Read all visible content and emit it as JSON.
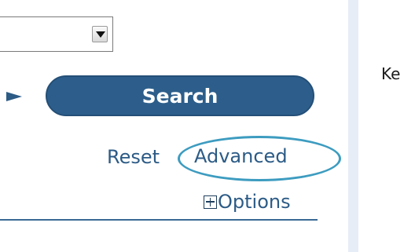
{
  "search_form": {
    "select": {
      "selected_value": ""
    },
    "search_label": "Search",
    "reset_label": "Reset",
    "advanced_label": "Advanced",
    "options_label": "Options"
  },
  "right_panel": {
    "keyword_label": "Ke"
  },
  "colors": {
    "button_bg": "#2d5e8b",
    "link": "#2c5b86",
    "highlight_ellipse": "#3d9cc0",
    "side_strip": "#e7edf7"
  },
  "icons": {
    "select_arrow": "chevron-down-icon",
    "expand": "plus-box-icon",
    "pointer": "arrow-right-icon"
  }
}
